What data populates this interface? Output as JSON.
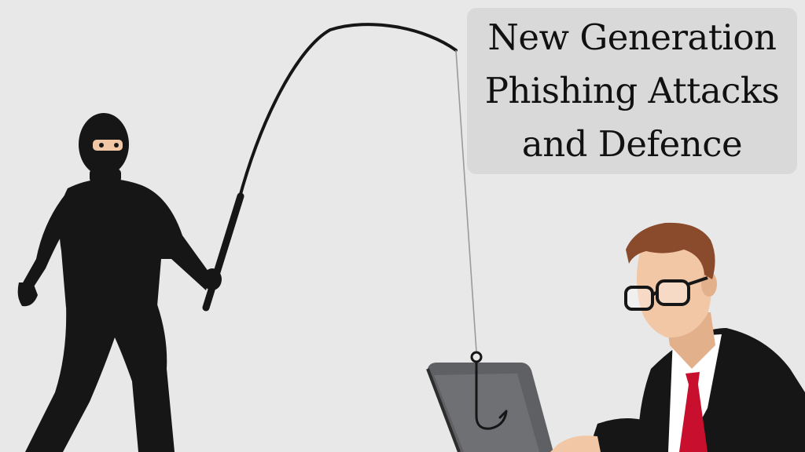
{
  "title": {
    "lines": [
      "New Generation",
      "Phishing Attacks",
      "and Defence"
    ]
  },
  "colors": {
    "background": "#e8e8e8",
    "title_box": "#d9d9d9",
    "title_text": "#111111",
    "attacker": "#161616",
    "skin": "#f1c7a6",
    "hair": "#8a4a2c",
    "tie": "#c8102e",
    "laptop_screen": "#5f6063"
  },
  "scene": {
    "attacker": "masked-thief-figure",
    "victim": "businessman-with-glasses",
    "rod": "fishing-rod",
    "hook": "fishing-hook",
    "device": "laptop"
  }
}
